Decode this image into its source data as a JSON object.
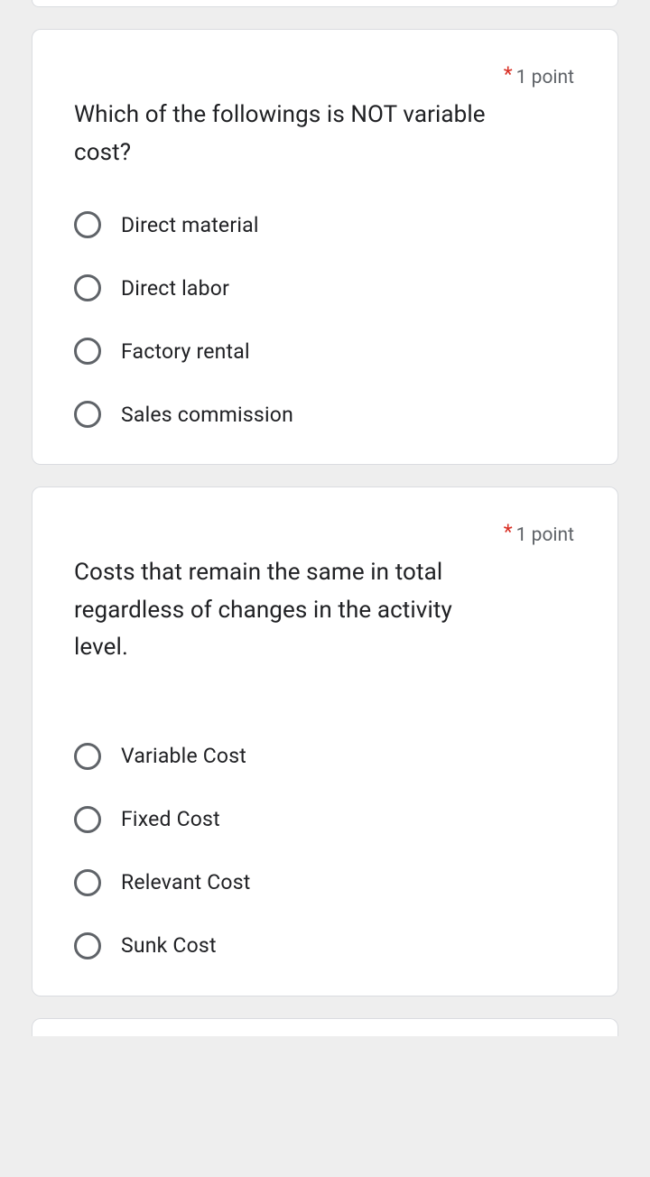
{
  "points_label": "1 point",
  "questions": [
    {
      "text": "Which of the followings is NOT variable cost?",
      "options": [
        "Direct material",
        "Direct labor",
        "Factory rental",
        "Sales commission"
      ]
    },
    {
      "text": "Costs that remain the same in total regardless of changes in the activity level.",
      "options": [
        "Variable Cost",
        "Fixed Cost",
        "Relevant Cost",
        "Sunk Cost"
      ]
    }
  ]
}
